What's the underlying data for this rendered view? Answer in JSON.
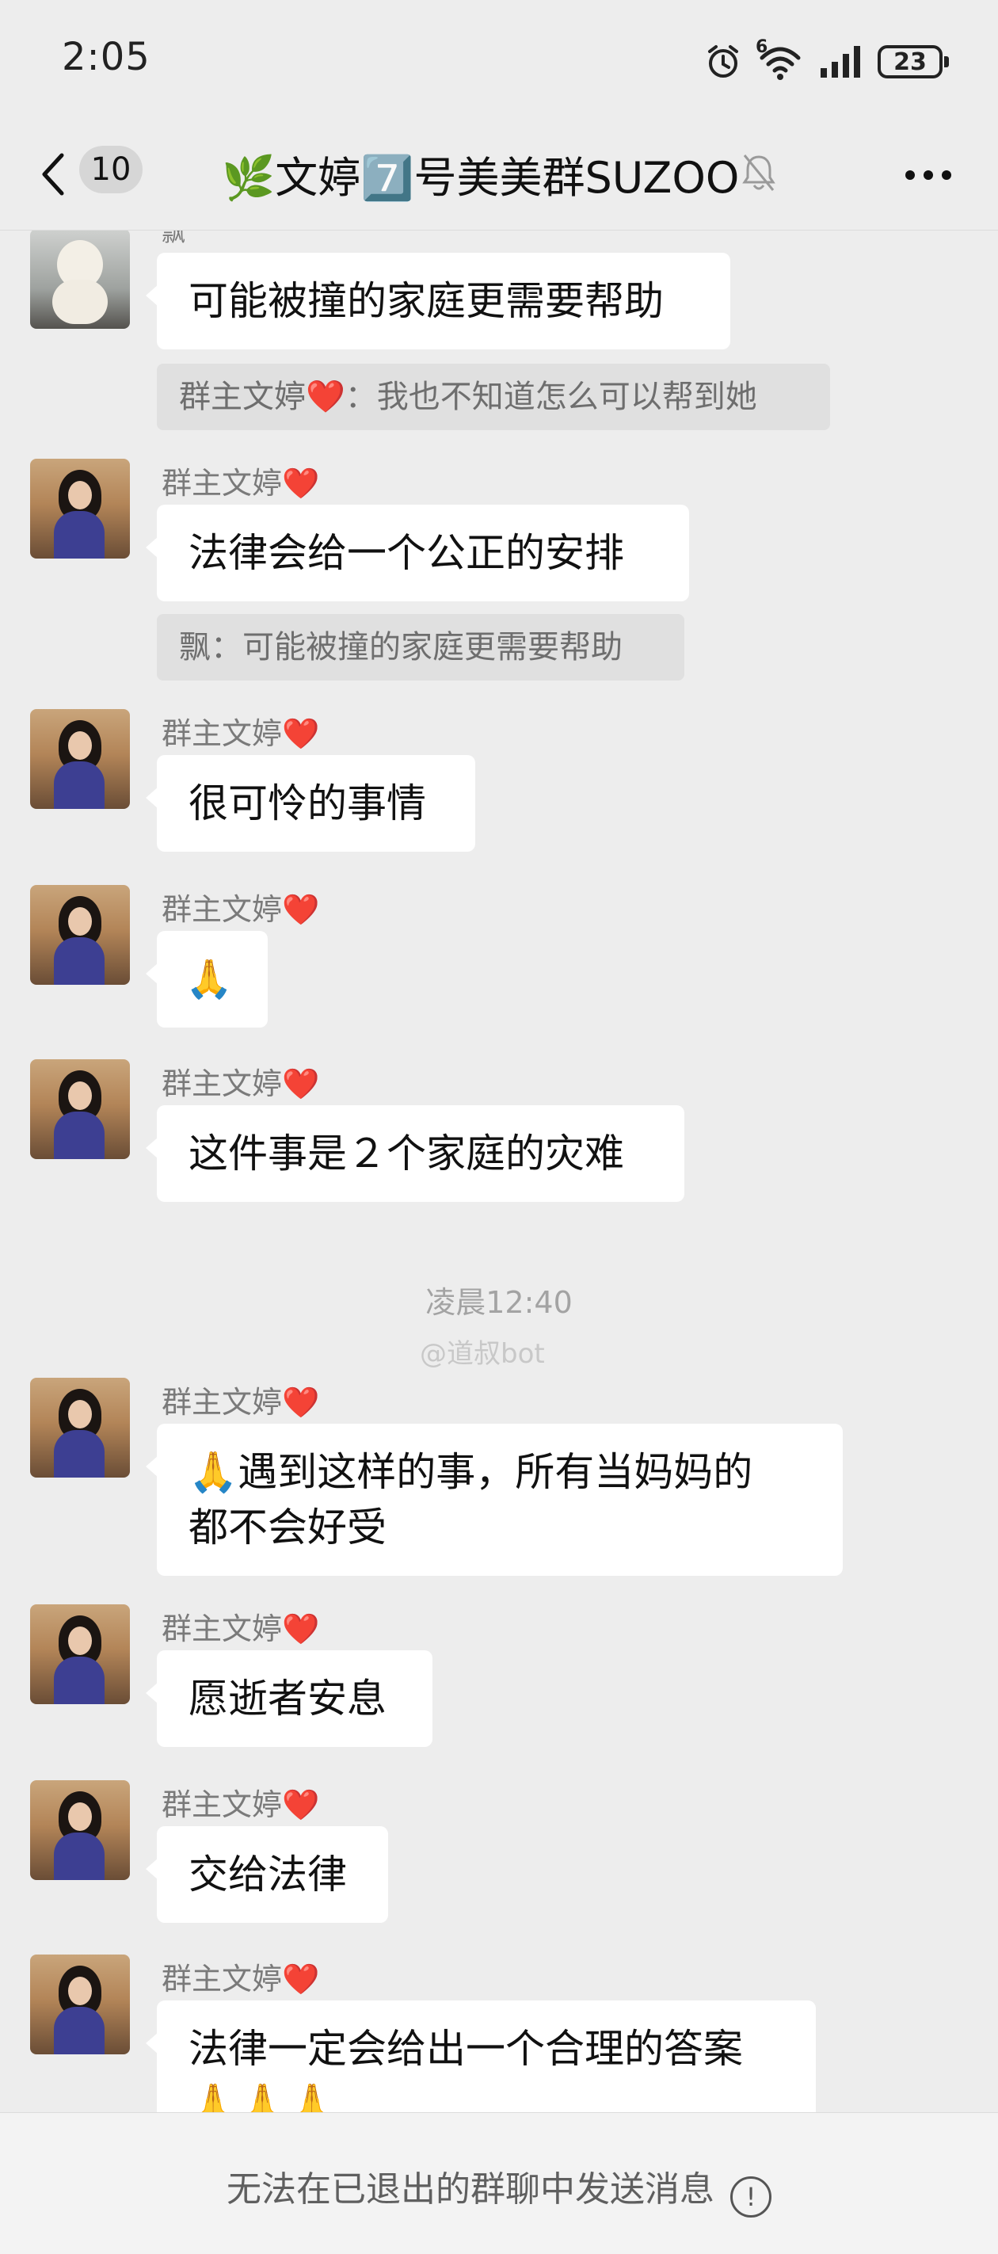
{
  "status_bar": {
    "time": "2:05",
    "battery": "23",
    "signal_label": "6"
  },
  "header": {
    "unread_count": "10",
    "title": "🌿文婷7️⃣号美美群SUZOO"
  },
  "messages": [
    {
      "sender_partial": "飘",
      "text": "可能被撞的家庭更需要帮助"
    },
    {
      "quote": "群主文婷❤️：我也不知道怎么可以帮到她"
    },
    {
      "sender": "群主文婷",
      "text": "法律会给一个公正的安排"
    },
    {
      "quote": "飘：可能被撞的家庭更需要帮助"
    },
    {
      "sender": "群主文婷",
      "text": "很可怜的事情"
    },
    {
      "sender": "群主文婷",
      "text": "🙏"
    },
    {
      "sender": "群主文婷",
      "text": "这件事是２个家庭的灾难"
    },
    {
      "timestamp": "凌晨12:40"
    },
    {
      "sender": "群主文婷",
      "text_line1": "🙏遇到这样的事，所有当妈妈的",
      "text_line2": "都不会好受"
    },
    {
      "sender": "群主文婷",
      "text": "愿逝者安息"
    },
    {
      "sender": "群主文婷",
      "text": "交给法律"
    },
    {
      "sender": "群主文婷",
      "text": "法律一定会给出一个合理的答案",
      "text_line2": "🙏🙏🙏"
    }
  ],
  "heart": "❤️",
  "watermark": "@道叔bot",
  "footer": {
    "notice": "无法在已退出的群聊中发送消息",
    "info_icon": "!"
  },
  "icons": [
    "back-chevron-icon",
    "mute-bell-icon",
    "more-icon",
    "alarm-icon",
    "wifi-icon",
    "signal-icon",
    "battery-icon",
    "info-icon"
  ]
}
